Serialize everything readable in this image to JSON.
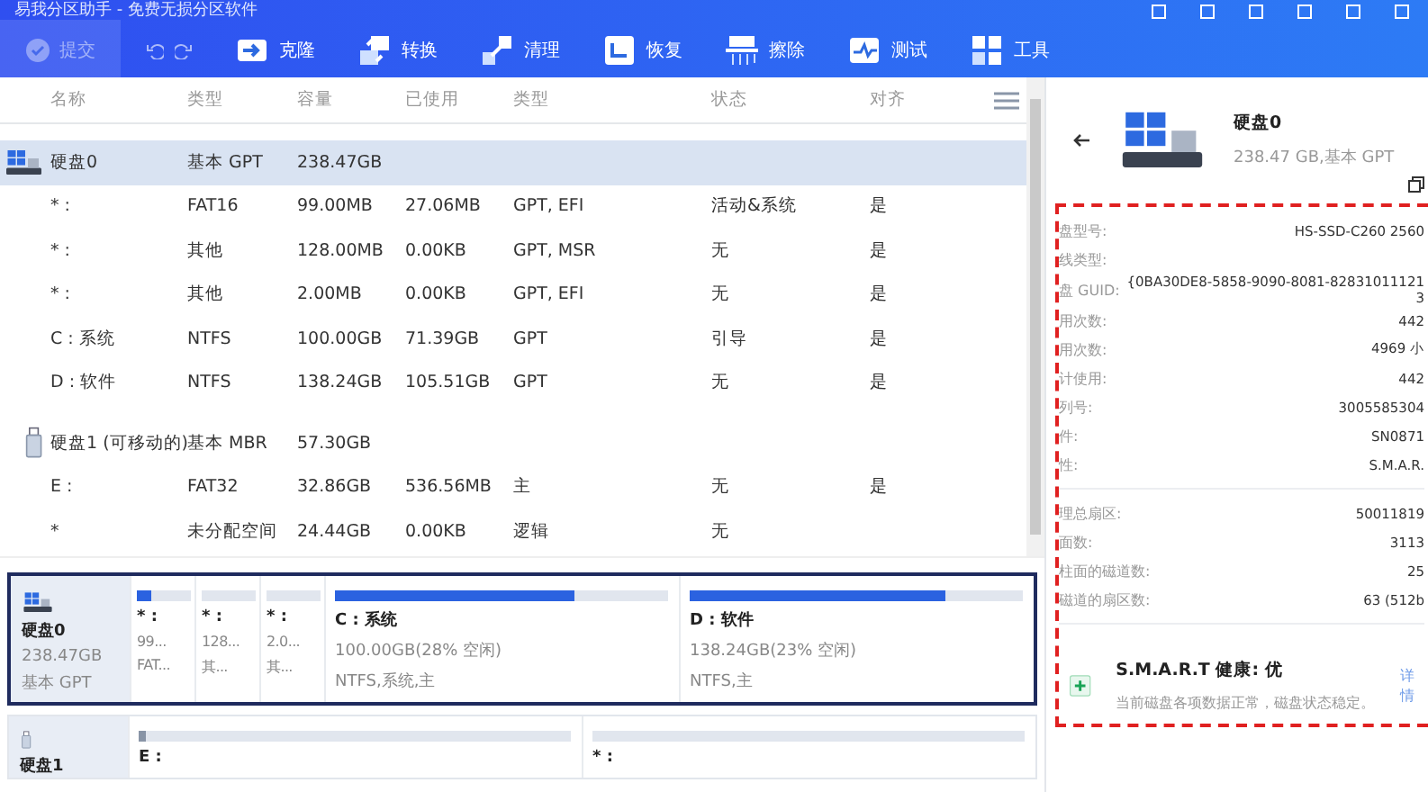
{
  "window": {
    "title": "易我分区助手 - 免费无损分区软件"
  },
  "toolbar": {
    "commit": {
      "label": "提交",
      "disabled": true
    },
    "items": [
      {
        "label": "克隆"
      },
      {
        "label": "转换"
      },
      {
        "label": "清理"
      },
      {
        "label": "恢复"
      },
      {
        "label": "擦除"
      },
      {
        "label": "测试"
      },
      {
        "label": "工具"
      }
    ]
  },
  "table": {
    "columns": [
      "名称",
      "类型",
      "容量",
      "已使用",
      "类型",
      "状态",
      "对齐"
    ],
    "disks": [
      {
        "kind": "ssd",
        "name": "硬盘0",
        "type": "基本 GPT",
        "capacity": "238.47GB",
        "selected": true,
        "children": [
          {
            "name": "* :",
            "fs": "FAT16",
            "capacity": "99.00MB",
            "used": "27.06MB",
            "type": "GPT, EFI",
            "status": "活动&系统",
            "aligned": "是"
          },
          {
            "name": "* :",
            "fs": "其他",
            "capacity": "128.00MB",
            "used": "0.00KB",
            "type": "GPT, MSR",
            "status": "无",
            "aligned": "是"
          },
          {
            "name": "* :",
            "fs": "其他",
            "capacity": "2.00MB",
            "used": "0.00KB",
            "type": "GPT, EFI",
            "status": "无",
            "aligned": "是"
          },
          {
            "name": "C : 系统",
            "fs": "NTFS",
            "capacity": "100.00GB",
            "used": "71.39GB",
            "type": "GPT",
            "status": "引导",
            "aligned": "是"
          },
          {
            "name": "D : 软件",
            "fs": "NTFS",
            "capacity": "138.24GB",
            "used": "105.51GB",
            "type": "GPT",
            "status": "无",
            "aligned": "是"
          }
        ]
      },
      {
        "kind": "usb",
        "name": "硬盘1 (可移动的)",
        "type": "基本 MBR",
        "capacity": "57.30GB",
        "selected": false,
        "children": [
          {
            "name": "E :",
            "fs": "FAT32",
            "capacity": "32.86GB",
            "used": "536.56MB",
            "type": "主",
            "status": "无",
            "aligned": "是"
          },
          {
            "name": "*",
            "fs": "未分配空间",
            "capacity": "24.44GB",
            "used": "0.00KB",
            "type": "逻辑",
            "status": "无"
          }
        ]
      }
    ]
  },
  "disk_map": [
    {
      "kind": "ssd",
      "name": "硬盘0",
      "capacity": "238.47GB",
      "type": "基本 GPT",
      "selected": true,
      "segments": [
        {
          "kind": "small",
          "label": "* :",
          "size": "99...",
          "info": "FAT...",
          "level": 0.27
        },
        {
          "kind": "small",
          "label": "* :",
          "size": "128...",
          "info": "其..."
        },
        {
          "kind": "small",
          "label": "* :",
          "size": "2.0...",
          "info": "其..."
        },
        {
          "kind": "wide",
          "label": "C : 系统",
          "size": "100.00GB(28% 空闲)",
          "info": "NTFS,系统,主",
          "level": 0.72
        },
        {
          "kind": "wide",
          "label": "D : 软件",
          "size": "138.24GB(23% 空闲)",
          "info": "NTFS,主",
          "level": 0.77
        }
      ]
    },
    {
      "kind": "usb",
      "name": "硬盘1",
      "selected": false,
      "segments": [
        {
          "kind": "wide",
          "label": "E :",
          "level": 0.015
        },
        {
          "kind": "wide",
          "label": "* :"
        }
      ]
    }
  ],
  "details": {
    "title": "硬盘0",
    "subtitle": "238.47 GB,基本 GPT",
    "groups": [
      [
        {
          "label": "盘型号:",
          "value": "HS-SSD-C260 2560"
        },
        {
          "label": "线类型:"
        },
        {
          "label": "盘 GUID:",
          "value": "{0BA30DE8-5858-9090-8081-828310111213"
        },
        {
          "label": "用次数:",
          "value": "442"
        },
        {
          "label": "用次数:",
          "value": "4969 小"
        },
        {
          "label": "计使用:",
          "value": "442"
        },
        {
          "label": "列号:",
          "value": "3005585304"
        },
        {
          "label": "件:",
          "value": "SN0871"
        },
        {
          "label": "性:",
          "value": "S.M.A.R."
        }
      ],
      [
        {
          "label": "理总扇区:",
          "value": "50011819"
        },
        {
          "label": "面数:",
          "value": "3113"
        },
        {
          "label": "柱面的磁道数:",
          "value": "25"
        },
        {
          "label": "磁道的扇区数:",
          "value": "63 (512b"
        }
      ]
    ],
    "health": {
      "title": "S.M.A.R.T 健康: 优",
      "text": "当前磁盘各项数据正常，磁盘状态稳定。",
      "link": "详情"
    }
  }
}
